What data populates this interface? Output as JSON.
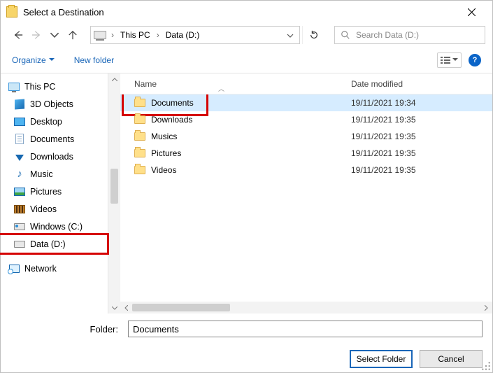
{
  "window": {
    "title": "Select a Destination"
  },
  "breadcrumb": {
    "pc": "This PC",
    "drive": "Data (D:)"
  },
  "search": {
    "placeholder": "Search Data (D:)"
  },
  "cmdbar": {
    "organize": "Organize",
    "newfolder": "New folder"
  },
  "columns": {
    "name": "Name",
    "date": "Date modified"
  },
  "tree": {
    "thispc": "This PC",
    "items": [
      {
        "label": "3D Objects"
      },
      {
        "label": "Desktop"
      },
      {
        "label": "Documents"
      },
      {
        "label": "Downloads"
      },
      {
        "label": "Music"
      },
      {
        "label": "Pictures"
      },
      {
        "label": "Videos"
      },
      {
        "label": "Windows  (C:)"
      },
      {
        "label": "Data (D:)"
      }
    ],
    "network": "Network"
  },
  "files": [
    {
      "name": "Documents",
      "date": "19/11/2021 19:34"
    },
    {
      "name": "Downloads",
      "date": "19/11/2021 19:35"
    },
    {
      "name": "Musics",
      "date": "19/11/2021 19:35"
    },
    {
      "name": "Pictures",
      "date": "19/11/2021 19:35"
    },
    {
      "name": "Videos",
      "date": "19/11/2021 19:35"
    }
  ],
  "footer": {
    "folder_label": "Folder:",
    "folder_value": "Documents",
    "select": "Select Folder",
    "cancel": "Cancel"
  }
}
